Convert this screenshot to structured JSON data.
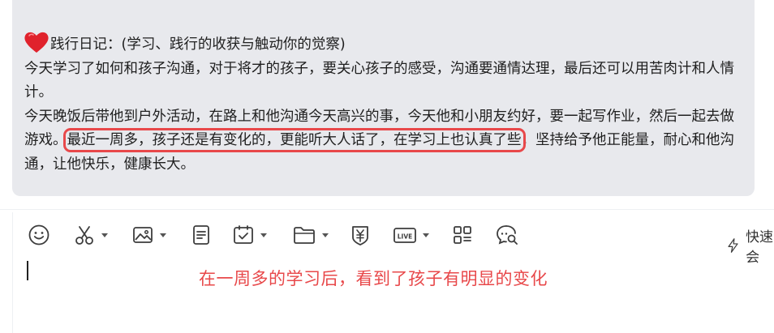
{
  "diary": {
    "title": "践行日记：(学习、践行的收获与触动你的觉察)",
    "para1": "今天学习了如何和孩子沟通，对于将才的孩子，要关心孩子的感受，沟通要通情达理，最后还可以用苦肉计和人情计。",
    "para2_before": "今天晚饭后带他到户外活动，在路上和他沟通今天高兴的事，今天他和小朋友约好，要一起写作业，然后一起去做游戏。",
    "para2_highlight": "最近一周多，孩子还是有变化的，更能听大人话了，在学习上也认真了些",
    "para2_after": "，坚持给予他正能量，耐心和他沟通，让他快乐，健康长大。"
  },
  "toolbar": {
    "items": [
      {
        "name": "emoji-button",
        "icon": "smiley-icon"
      },
      {
        "name": "screenshot-button",
        "icon": "scissors-icon"
      },
      {
        "name": "image-button",
        "icon": "image-icon"
      },
      {
        "name": "document-button",
        "icon": "document-icon"
      },
      {
        "name": "schedule-button",
        "icon": "calendar-check-icon"
      },
      {
        "name": "folder-button",
        "icon": "folder-icon"
      },
      {
        "name": "red-packet-button",
        "icon": "yuan-shield-icon"
      },
      {
        "name": "live-button",
        "icon": "live-icon"
      },
      {
        "name": "apps-button",
        "icon": "apps-grid-icon"
      },
      {
        "name": "chat-search-button",
        "icon": "chat-search-icon"
      }
    ],
    "quick_meeting_label": "快速会"
  },
  "annotation": {
    "text": "在一周多的学习后，看到了孩子有明显的变化",
    "color": "#e8484a"
  },
  "colors": {
    "card_bg": "#e8e9ed",
    "highlight_border": "#e8484a",
    "heart": "#e0222c"
  }
}
